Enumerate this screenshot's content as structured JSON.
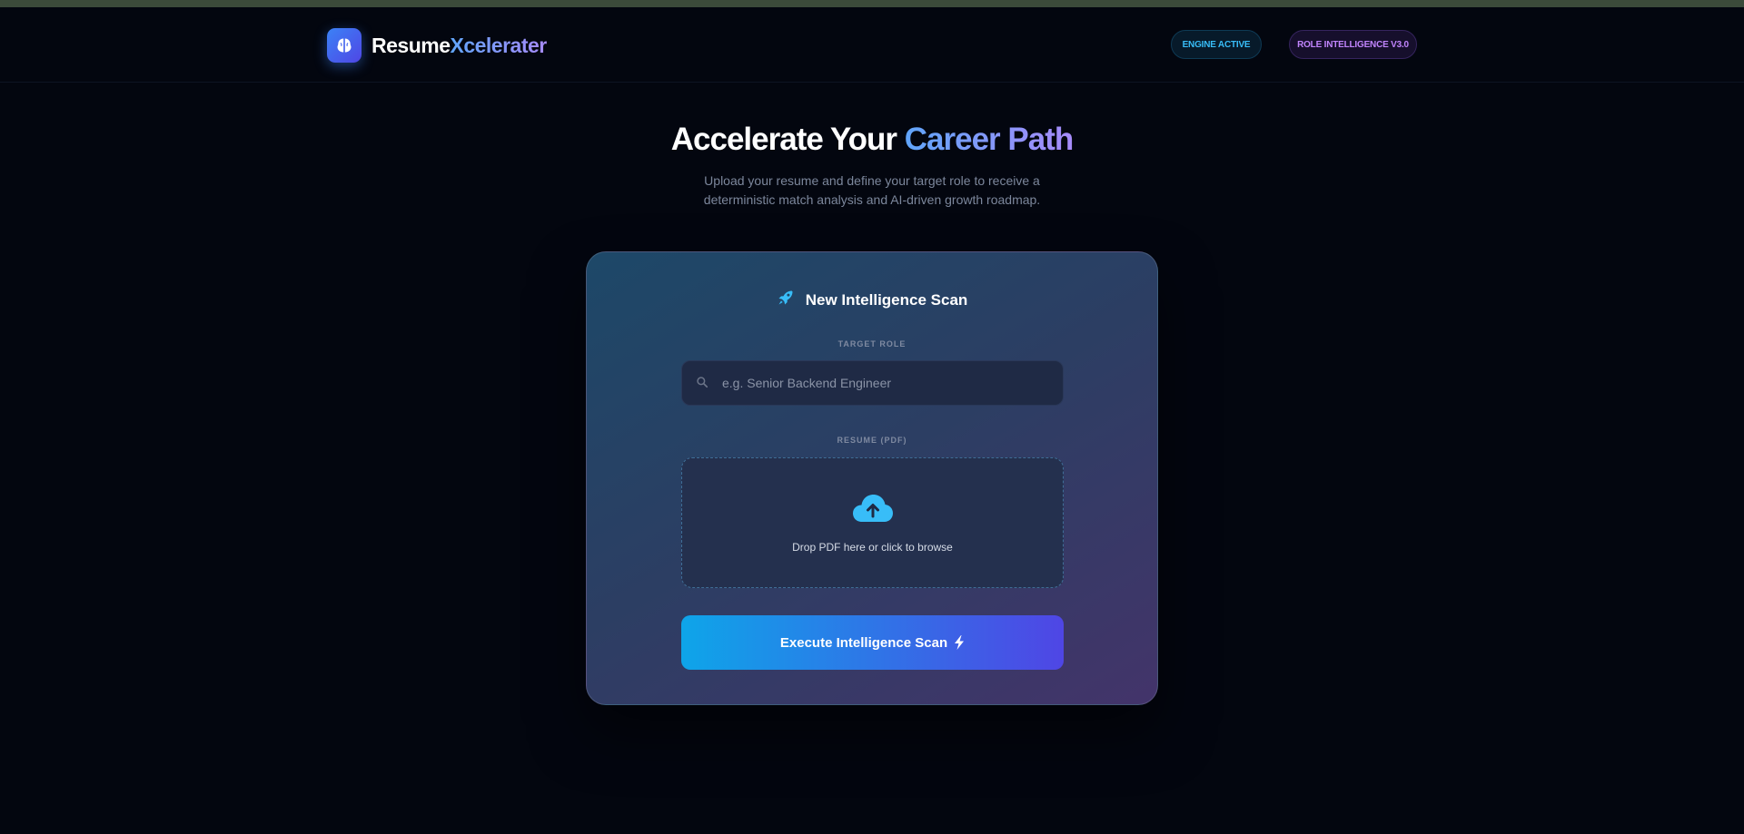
{
  "brand": {
    "name_part1": "Resume",
    "name_part2": "Xcelerater",
    "logo_icon": "brain-icon"
  },
  "header": {
    "badges": [
      {
        "label": "ENGINE ACTIVE",
        "color": "#38bdf8"
      },
      {
        "label": "ROLE INTELLIGENCE V3.0",
        "color": "#c084fc"
      }
    ]
  },
  "hero": {
    "title_main": "Accelerate Your ",
    "title_accent": "Career Path",
    "subtitle": "Upload your resume and define your target role to receive a deterministic match analysis and AI-driven growth roadmap."
  },
  "scan_card": {
    "title": "New Intelligence Scan",
    "title_icon": "rocket-icon",
    "target_role": {
      "label": "TARGET ROLE",
      "placeholder": "e.g. Senior Backend Engineer",
      "value": "",
      "icon": "search-icon"
    },
    "resume": {
      "label": "RESUME (PDF)",
      "dropzone_text": "Drop PDF here or click to browse",
      "icon": "cloud-upload-icon"
    },
    "submit": {
      "label": "Execute Intelligence Scan",
      "icon": "lightning-bolt-icon"
    }
  },
  "colors": {
    "background": "#03060f",
    "accent_blue": "#60a5fa",
    "accent_purple": "#a78bfa",
    "button_start": "#0ea5e9",
    "button_end": "#4f46e5"
  }
}
